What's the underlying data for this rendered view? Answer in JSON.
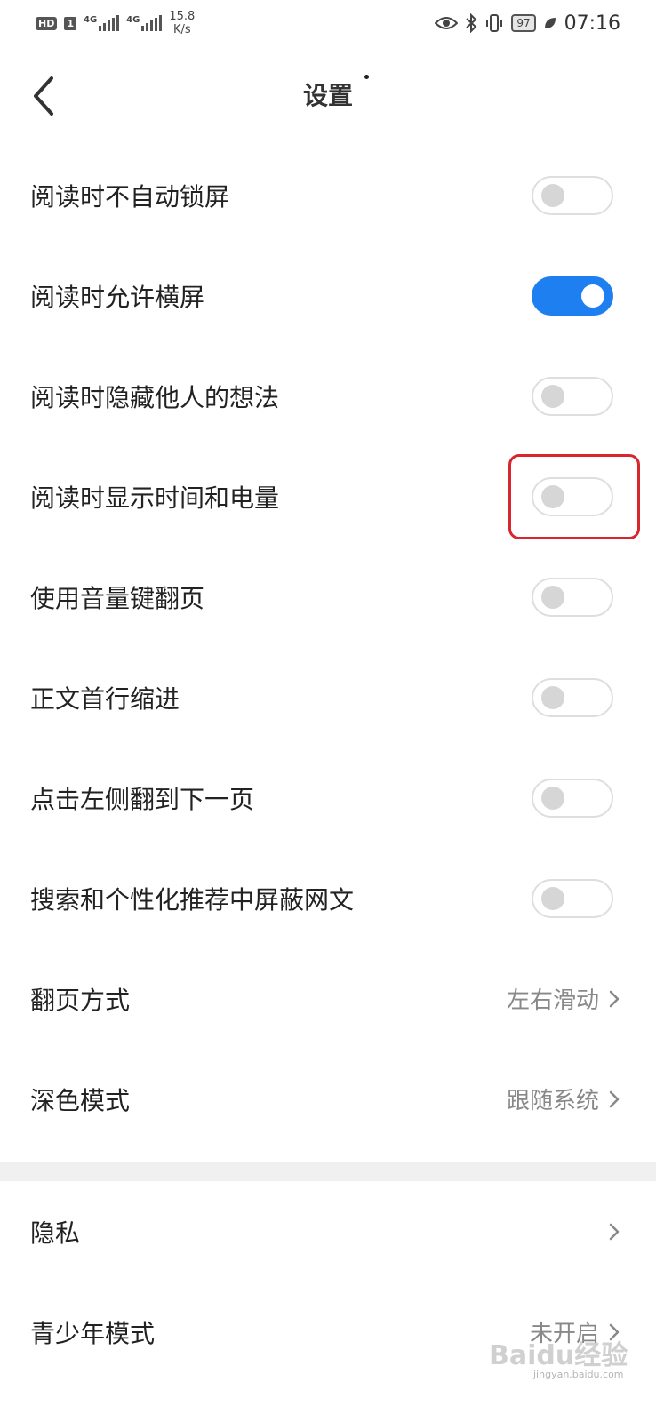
{
  "status_bar": {
    "hd": "HD",
    "sim1": "1",
    "net1": "4G",
    "net2": "4G",
    "speed_value": "15.8",
    "speed_unit": "K/s",
    "battery": "97",
    "time": "07:16",
    "icons": [
      "eye-icon",
      "bluetooth-icon",
      "vibrate-icon",
      "battery-icon",
      "leaf-icon"
    ]
  },
  "nav": {
    "title": "设置",
    "back_icon": "chevron-left-icon"
  },
  "settings": {
    "toggles": [
      {
        "label": "阅读时不自动锁屏",
        "on": false
      },
      {
        "label": "阅读时允许横屏",
        "on": true
      },
      {
        "label": "阅读时隐藏他人的想法",
        "on": false
      },
      {
        "label": "阅读时显示时间和电量",
        "on": false
      },
      {
        "label": "使用音量键翻页",
        "on": false
      },
      {
        "label": "正文首行缩进",
        "on": false
      },
      {
        "label": "点击左侧翻到下一页",
        "on": false
      },
      {
        "label": "搜索和个性化推荐中屏蔽网文",
        "on": false
      }
    ],
    "nav_items": [
      {
        "label": "翻页方式",
        "value": "左右滑动"
      },
      {
        "label": "深色模式",
        "value": "跟随系统"
      }
    ],
    "section2": [
      {
        "label": "隐私",
        "value": ""
      },
      {
        "label": "青少年模式",
        "value": "未开启"
      }
    ]
  },
  "watermark": {
    "brand": "Baidu经验",
    "url": "jingyan.baidu.com"
  },
  "colors": {
    "accent": "#1e7ff0",
    "highlight": "#d8262f",
    "toggle_off_knob": "#d6d6d6"
  }
}
